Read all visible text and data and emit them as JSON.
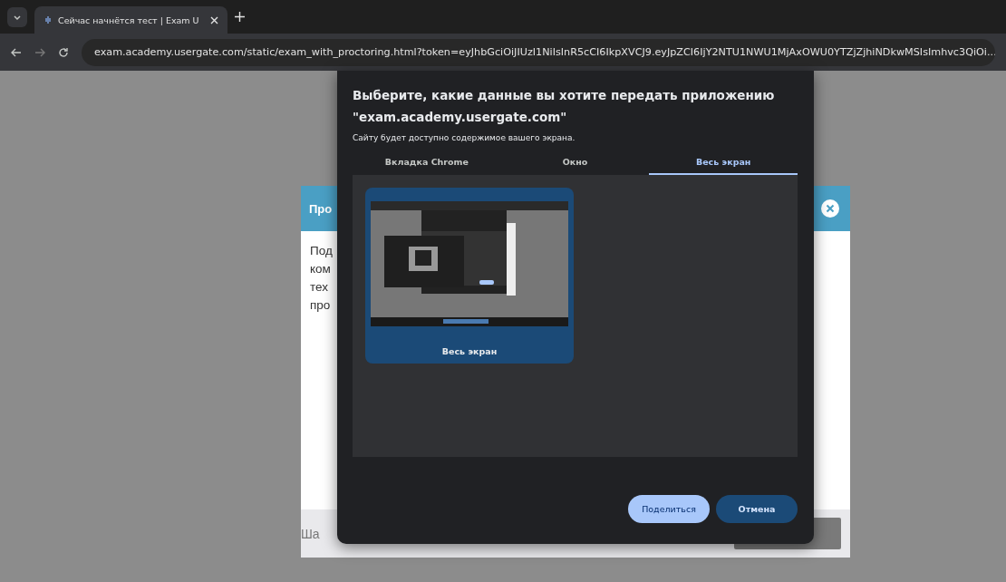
{
  "browser": {
    "tabs": [
      {
        "title": "Сейчас начнётся тест | Exam U",
        "selected": true
      }
    ],
    "url": "exam.academy.usergate.com/static/exam_with_proctoring.html?token=eyJhbGciOiJIUzI1NiIsInR5cCI6IkpXVCJ9.eyJpZCI6IjY2NTU1NWU1MjAxOWU0YTZjZjhiNDkwMSIsImhvc3QiOi..."
  },
  "background_card": {
    "title": "Про",
    "body_lines": [
      "Под",
      "ком",
      "тех",
      "про"
    ],
    "footer_text": "Ша"
  },
  "share_dialog": {
    "title": "Выберите, какие данные вы хотите передать приложению \"exam.academy.usergate.com\"",
    "subtitle": "Сайту будет доступно содержимое вашего экрана.",
    "tabs": [
      {
        "label": "Вкладка Chrome",
        "selected": false
      },
      {
        "label": "Окно",
        "selected": false
      },
      {
        "label": "Весь экран",
        "selected": true
      }
    ],
    "sources": [
      {
        "label": "Весь экран",
        "selected": true
      }
    ],
    "buttons": [
      {
        "label": "Поделиться",
        "kind": "primary"
      },
      {
        "label": "Отмена",
        "kind": "secondary"
      }
    ]
  }
}
